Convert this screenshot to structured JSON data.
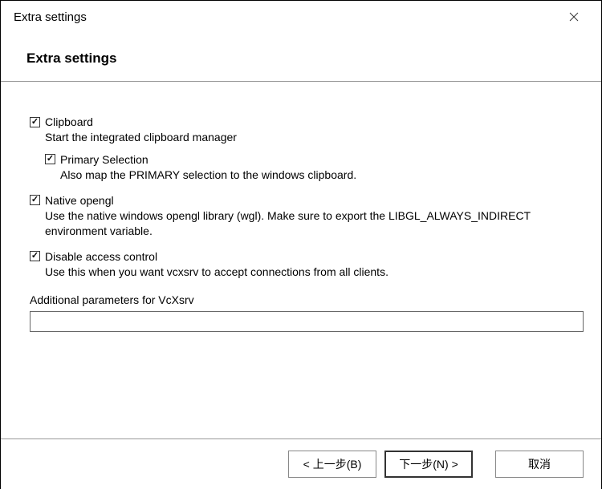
{
  "window": {
    "title": "Extra settings"
  },
  "header": {
    "heading": "Extra settings"
  },
  "options": {
    "clipboard": {
      "label": "Clipboard",
      "desc": "Start the integrated clipboard manager",
      "checked": true,
      "primary_selection": {
        "label": "Primary Selection",
        "desc": "Also map the PRIMARY selection to the windows clipboard.",
        "checked": true
      }
    },
    "native_opengl": {
      "label": "Native opengl",
      "desc": "Use the native windows opengl library (wgl). Make sure to export the LIBGL_ALWAYS_INDIRECT environment variable.",
      "checked": true
    },
    "disable_access_control": {
      "label": "Disable access control",
      "desc": "Use this when you want vcxsrv to accept connections from all clients.",
      "checked": true
    }
  },
  "params": {
    "label": "Additional parameters for VcXsrv",
    "value": ""
  },
  "buttons": {
    "back": "< 上一步(B)",
    "next": "下一步(N) >",
    "cancel": "取消"
  }
}
